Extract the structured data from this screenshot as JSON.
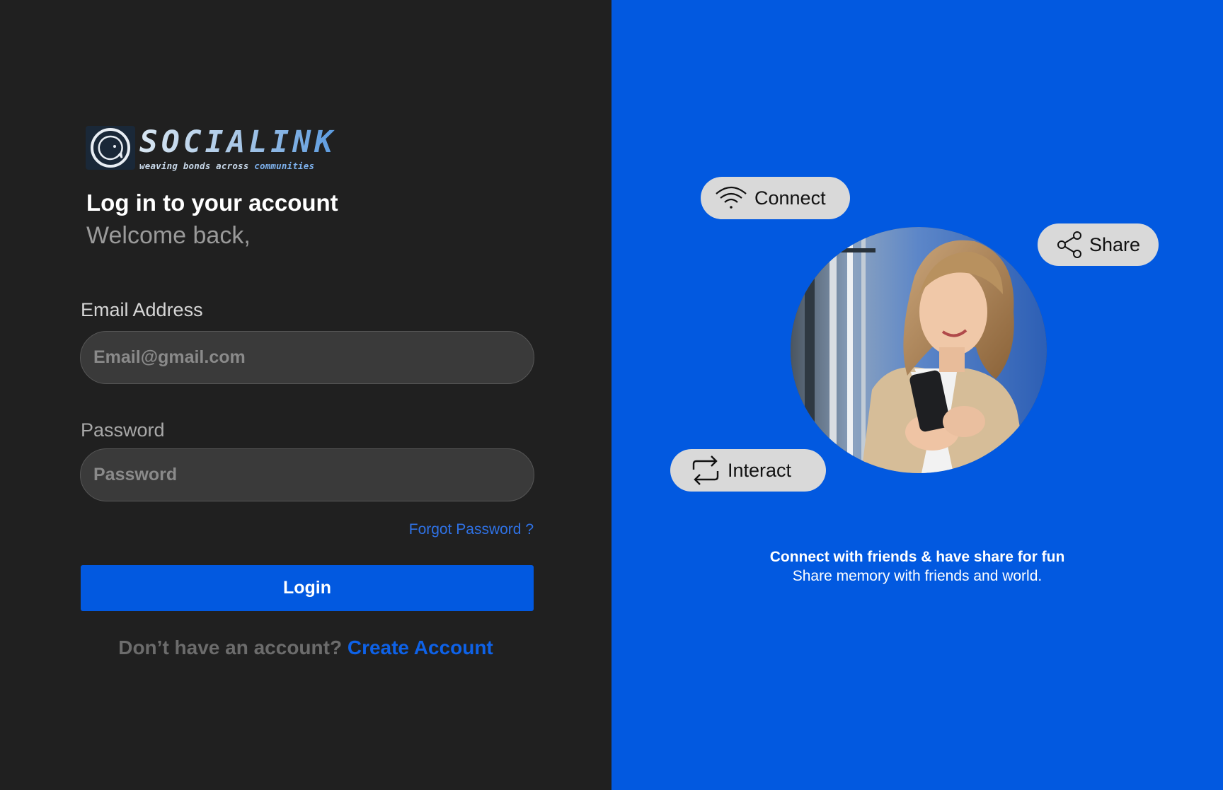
{
  "brand": {
    "name": "SOCIALINK",
    "tagline_prefix": "weaving bonds across ",
    "tagline_accent": "communities"
  },
  "login": {
    "title": "Log in to your account",
    "subtitle": "Welcome back,",
    "email_label": "Email Address",
    "email_placeholder": "Email@gmail.com",
    "email_value": "",
    "password_label": "Password",
    "password_placeholder": "Password",
    "password_value": "",
    "forgot_password": "Forgot Password ?",
    "login_button": "Login",
    "no_account_text": "Don’t have an account? ",
    "create_account": "Create Account"
  },
  "hero": {
    "pills": {
      "connect": "Connect",
      "share": "Share",
      "interact": "Interact"
    },
    "headline": "Connect with friends & have share for fun",
    "subline": "Share memory with friends and world."
  },
  "colors": {
    "left_bg": "#202020",
    "right_bg": "#0259e0",
    "accent": "#0259e0",
    "link": "#2f72e6",
    "input_bg": "#3a3a3a",
    "pill_bg": "#d9d9d9"
  },
  "icons": {
    "logo": "chat-bubble-circle-icon",
    "connect": "wifi-icon",
    "share": "share-icon",
    "interact": "repeat-arrows-icon"
  }
}
